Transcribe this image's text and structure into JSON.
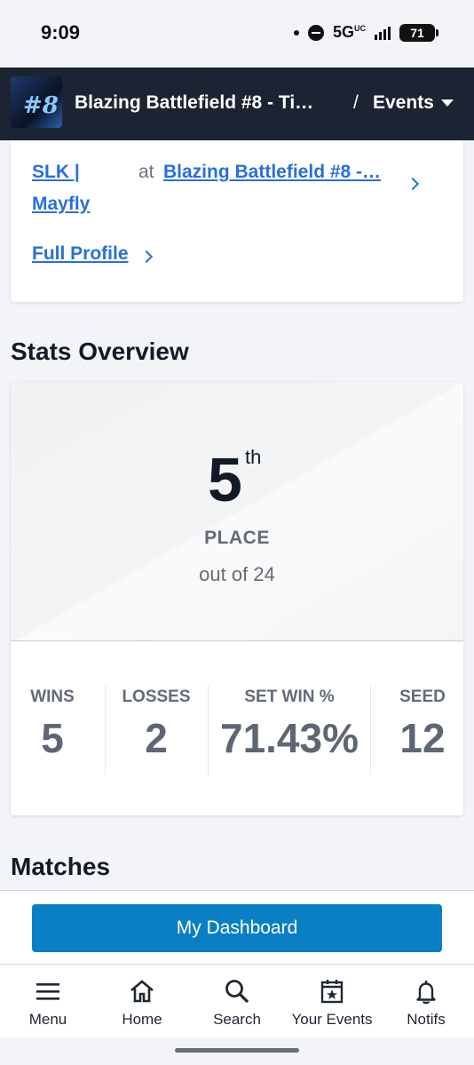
{
  "status_bar": {
    "time": "9:09",
    "network": "5G",
    "network_sup": "UC",
    "battery": "71"
  },
  "header": {
    "event_title": "Blazing Battlefield #8 - Ti…",
    "separator": "/",
    "events_label": "Events",
    "thumb_text": "#8"
  },
  "profile": {
    "player_name": "SLK | Mayfly",
    "at_label": "at",
    "event_link": "Blazing Battlefield #8 -…",
    "full_profile_label": "Full Profile"
  },
  "stats_overview": {
    "title": "Stats Overview",
    "place_number": "5",
    "place_suffix": "th",
    "place_label": "PLACE",
    "place_out_of": "out of 24",
    "stats": [
      {
        "label": "WINS",
        "value": "5"
      },
      {
        "label": "LOSSES",
        "value": "2"
      },
      {
        "label": "SET WIN %",
        "value": "71.43%"
      },
      {
        "label": "SEED",
        "value": "12"
      }
    ]
  },
  "matches": {
    "title": "Matches"
  },
  "dashboard": {
    "button_label": "My Dashboard"
  },
  "bottom_nav": {
    "items": [
      {
        "label": "Menu",
        "icon": "menu-icon"
      },
      {
        "label": "Home",
        "icon": "home-icon"
      },
      {
        "label": "Search",
        "icon": "search-icon"
      },
      {
        "label": "Your Events",
        "icon": "calendar-star-icon"
      },
      {
        "label": "Notifs",
        "icon": "bell-icon"
      }
    ]
  },
  "colors": {
    "nav_bg": "#1c2333",
    "link": "#2a6fd6",
    "button": "#0a7fc4"
  }
}
